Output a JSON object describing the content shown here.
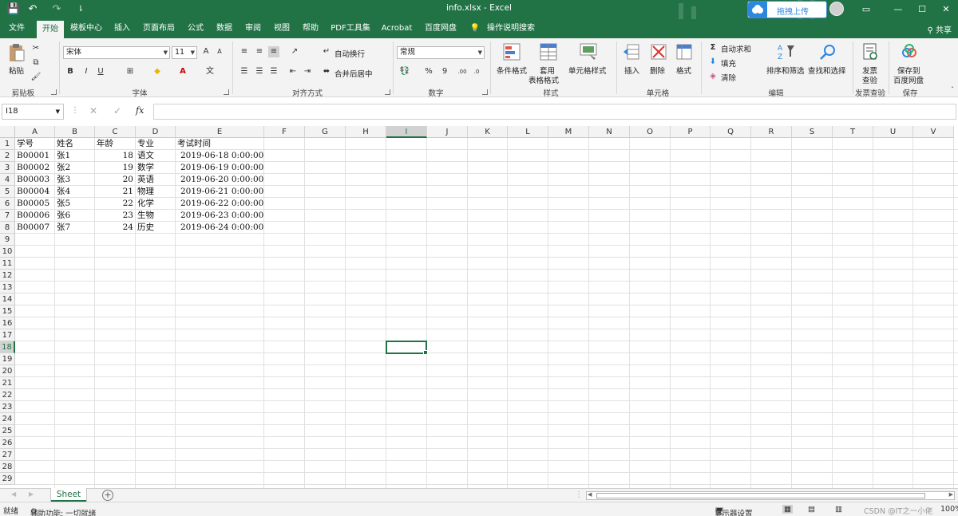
{
  "window": {
    "title": "info.xlsx - Excel",
    "upload_label": "拖拽上传",
    "controls": [
      "▭",
      "—",
      "☐",
      "✕"
    ]
  },
  "quick_access": {
    "save": "💾",
    "undo": "↶",
    "redo": "↷",
    "customize": "⇂"
  },
  "menu": {
    "tabs": [
      "文件",
      "开始",
      "模板中心",
      "插入",
      "页面布局",
      "公式",
      "数据",
      "审阅",
      "视图",
      "帮助",
      "PDF工具集",
      "Acrobat",
      "百度网盘",
      "操作说明搜索"
    ],
    "active": "开始",
    "share_label": "共享"
  },
  "ribbon": {
    "clipboard": {
      "paste": "粘贴",
      "label": "剪贴板"
    },
    "font": {
      "name": "宋体",
      "size": "11",
      "bold": "B",
      "italic": "I",
      "underline": "U",
      "grow": "A",
      "shrink": "A",
      "label": "字体"
    },
    "alignment": {
      "wrap": "自动换行",
      "merge": "合并后居中",
      "label": "对齐方式"
    },
    "number": {
      "format": "常规",
      "percent": "%",
      "comma": "9",
      "label": "数字"
    },
    "styles": {
      "conditional": "条件格式",
      "table_line1": "套用",
      "table_line2": "表格格式",
      "cell_styles": "单元格样式",
      "label": "样式"
    },
    "cells": {
      "insert": "插入",
      "delete": "删除",
      "format": "格式",
      "label": "单元格"
    },
    "editing": {
      "autosum": "自动求和",
      "fill": "填充",
      "clear": "清除",
      "sort": "排序和筛选",
      "find": "查找和选择",
      "label": "编辑"
    },
    "invoice": {
      "line1": "发票",
      "line2": "查验",
      "label": "发票查验"
    },
    "save": {
      "line1": "保存到",
      "line2": "百度网盘",
      "label": "保存"
    }
  },
  "formula_bar": {
    "name_box": "I18",
    "fx": "fx",
    "value": ""
  },
  "grid": {
    "columns": [
      "A",
      "B",
      "C",
      "D",
      "E",
      "F",
      "G",
      "H",
      "I",
      "J",
      "K",
      "L",
      "M",
      "N",
      "O",
      "P",
      "Q",
      "R",
      "S",
      "T",
      "U",
      "V"
    ],
    "rows": [
      "1",
      "2",
      "3",
      "4",
      "5",
      "6",
      "7",
      "8",
      "9",
      "10",
      "11",
      "12",
      "13",
      "14",
      "15",
      "16",
      "17",
      "18",
      "19",
      "20",
      "21",
      "22",
      "23",
      "24",
      "25",
      "26",
      "27",
      "28",
      "29"
    ],
    "selected_col": "I",
    "selected_row": "18",
    "data": [
      [
        "学号",
        "姓名",
        "年龄",
        "专业",
        "考试时间"
      ],
      [
        "B00001",
        "张1",
        "18",
        "语文",
        "2019-06-18 0:00:00"
      ],
      [
        "B00002",
        "张2",
        "19",
        "数学",
        "2019-06-19 0:00:00"
      ],
      [
        "B00003",
        "张3",
        "20",
        "英语",
        "2019-06-20 0:00:00"
      ],
      [
        "B00004",
        "张4",
        "21",
        "物理",
        "2019-06-21 0:00:00"
      ],
      [
        "B00005",
        "张5",
        "22",
        "化学",
        "2019-06-22 0:00:00"
      ],
      [
        "B00006",
        "张6",
        "23",
        "生物",
        "2019-06-23 0:00:00"
      ],
      [
        "B00007",
        "张7",
        "24",
        "历史",
        "2019-06-24 0:00:00"
      ]
    ]
  },
  "sheets": {
    "tabs": [
      "Sheet"
    ],
    "add": "+"
  },
  "status": {
    "ready": "就绪",
    "accessibility": "辅助功能: 一切就绪",
    "display_settings": "显示器设置",
    "zoom": "100%",
    "watermark": "CSDN @IT之一小佬"
  },
  "colors": {
    "brand": "#217346",
    "accent_blue": "#2d87e0"
  }
}
